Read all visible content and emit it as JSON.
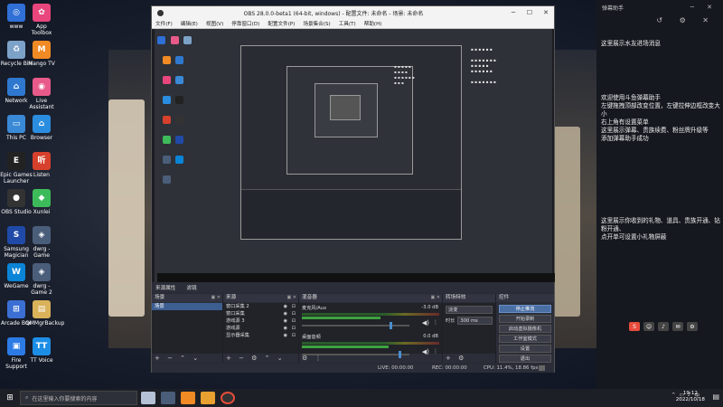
{
  "desktop": {
    "icons": [
      {
        "label": "www",
        "color": "#2f6fd6",
        "glyph": "◎"
      },
      {
        "label": "Recycle Bin",
        "color": "#7da2c8",
        "glyph": "♻"
      },
      {
        "label": "Network",
        "color": "#2f78d0",
        "glyph": "⌂"
      },
      {
        "label": "This PC",
        "color": "#3a89d6",
        "glyph": "▭"
      },
      {
        "label": "Epic Games Launcher",
        "color": "#222",
        "glyph": "E"
      },
      {
        "label": "OBS Studio",
        "color": "#333",
        "glyph": "●"
      },
      {
        "label": "Samsung Magician",
        "color": "#1f4aa8",
        "glyph": "S"
      },
      {
        "label": "WeGame",
        "color": "#0a84d6",
        "glyph": "W"
      },
      {
        "label": "Arcade Box",
        "color": "#3b6fd3",
        "glyph": "⊞"
      },
      {
        "label": "Fire Support",
        "color": "#2c7be5",
        "glyph": "▣"
      }
    ],
    "icons_col2": [
      {
        "label": "App Toolbox",
        "color": "#e8467c",
        "glyph": "✿"
      },
      {
        "label": "Mango TV",
        "color": "#f08a24",
        "glyph": "M"
      },
      {
        "label": "Live Assistant",
        "color": "#e85a8a",
        "glyph": "◉"
      },
      {
        "label": "Browser",
        "color": "#2a8de0",
        "glyph": "⌂"
      },
      {
        "label": "Listen",
        "color": "#d6402c",
        "glyph": "听"
      },
      {
        "label": "Xunlei",
        "color": "#3dbb5a",
        "glyph": "◆"
      },
      {
        "label": "dwrg - Game",
        "color": "#4a5e7a",
        "glyph": "◈"
      },
      {
        "label": "dwrg - Game 2",
        "color": "#4a5e7a",
        "glyph": "◈"
      },
      {
        "label": "QMMgrBackup",
        "color": "#d9b25a",
        "glyph": "▤"
      },
      {
        "label": "TT Voice",
        "color": "#1d8ee6",
        "glyph": "TT"
      }
    ]
  },
  "obs": {
    "title": "OBS 28.0.0-beta1 (64-bit, windows) - 配置文件: 未命名 - 场景: 未命名",
    "menu": [
      "文件(F)",
      "编辑(E)",
      "视图(V)",
      "停靠窗口(D)",
      "配置文件(P)",
      "场景集合(S)",
      "工具(T)",
      "帮助(H)"
    ],
    "tabs": [
      "来源属性",
      "滤镜"
    ],
    "docks": {
      "scenes": {
        "title": "场景",
        "items": [
          "场景"
        ]
      },
      "sources": {
        "title": "来源",
        "items": [
          "窗口采集 2",
          "窗口采集",
          "游戏源 3",
          "游戏源",
          "显示器采集"
        ]
      },
      "mixer": {
        "title": "混音器",
        "channels": [
          {
            "name": "麦克风/Aux",
            "db": "-3.0 dB",
            "level": 0.82
          },
          {
            "name": "桌面音频",
            "db": "0.0 dB",
            "level": 0.9
          }
        ]
      },
      "transitions": {
        "title": "转场特效",
        "select": "淡变",
        "duration_label": "时长",
        "duration": "300 ms"
      },
      "controls": {
        "title": "控件",
        "buttons": [
          "停止推流",
          "开始录制",
          "启动虚拟摄像机",
          "工作室模式",
          "设置",
          "退出"
        ]
      }
    },
    "status": {
      "live": "LIVE: 00:00:00",
      "rec": "REC: 00:00:00",
      "cpu": "CPU: 11.4%, 18.86 fps"
    }
  },
  "chat": {
    "header": "弹幕助手",
    "lines": [
      "这里展示水友进场消息",
      "欢迎使用斗鱼弹幕助手\n左键拖拽顶部改变位置，左键拉伸边框改变大小\n右上角有设置菜单\n这里展示弹幕、贵族续费、粉丝牌升级等\n添加弹幕助手成功",
      "这里展示你收到的礼物、道具、贵族开通、钻粉开通、\n点开单可设置小礼物屏蔽"
    ]
  },
  "taskbar": {
    "search_placeholder": "在这里输入你要搜索的内容",
    "time": "19:12",
    "date": "2022/10/18"
  }
}
